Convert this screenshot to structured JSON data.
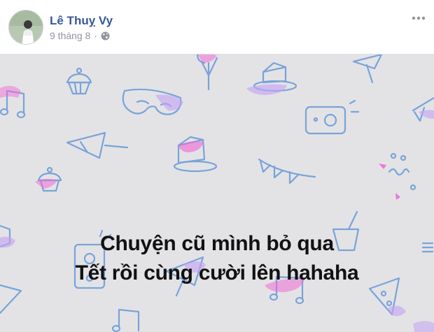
{
  "post": {
    "author": "Lê Thuỵ Vy",
    "date": "9 tháng 8",
    "separator": "·",
    "privacy_icon": "globe-icon",
    "more_icon": "more-options-icon",
    "avatar_icon": "profile-photo",
    "text_line1": "Chuyện cũ mình bỏ qua",
    "text_line2": "Tết rồi cùng cười lên hahaha"
  },
  "colors": {
    "author_link": "#365899",
    "meta_text": "#90949c",
    "background": "#e3e3e6",
    "doodle_blue": "#7aa3d8",
    "doodle_pink": "#f06ad6",
    "doodle_purple": "#c3a2f2"
  }
}
